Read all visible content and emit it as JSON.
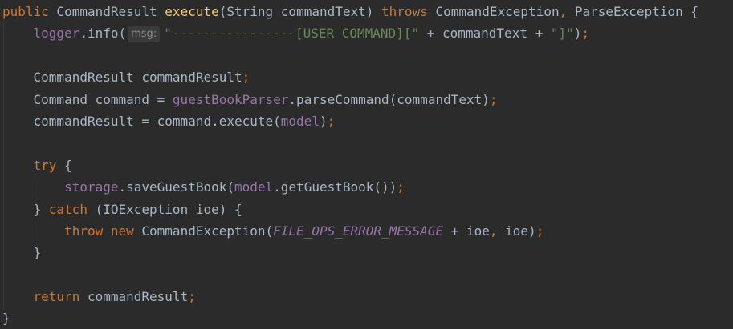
{
  "lines": [
    [
      {
        "t": "public",
        "c": "kw"
      },
      {
        "t": " CommandResult "
      },
      {
        "t": "execute",
        "c": "fn"
      },
      {
        "t": "(String commandText) "
      },
      {
        "t": "throws",
        "c": "kw"
      },
      {
        "t": " CommandException"
      },
      {
        "t": ",",
        "c": "kw"
      },
      {
        "t": " ParseException {"
      }
    ],
    [
      {
        "t": "    "
      },
      {
        "t": "logger",
        "c": "fld"
      },
      {
        "t": ".info("
      },
      {
        "t": "msg:",
        "c": "hint"
      },
      {
        "t": "\"----------------[USER COMMAND][\"",
        "c": "str"
      },
      {
        "t": " + commandText + "
      },
      {
        "t": "\"]\"",
        "c": "str"
      },
      {
        "t": ")"
      },
      {
        "t": ";",
        "c": "kw"
      }
    ],
    [],
    [
      {
        "t": "    CommandResult commandResult"
      },
      {
        "t": ";",
        "c": "kw"
      }
    ],
    [
      {
        "t": "    Command command = "
      },
      {
        "t": "guestBookParser",
        "c": "fld"
      },
      {
        "t": ".parseCommand(commandText)"
      },
      {
        "t": ";",
        "c": "kw"
      }
    ],
    [
      {
        "t": "    commandResult = command.execute("
      },
      {
        "t": "model",
        "c": "fld"
      },
      {
        "t": ")"
      },
      {
        "t": ";",
        "c": "kw"
      }
    ],
    [],
    [
      {
        "t": "    "
      },
      {
        "t": "try",
        "c": "kw"
      },
      {
        "t": " {"
      }
    ],
    [
      {
        "t": "        "
      },
      {
        "t": "storage",
        "c": "fld"
      },
      {
        "t": ".saveGuestBook("
      },
      {
        "t": "model",
        "c": "fld"
      },
      {
        "t": ".getGuestBook())"
      },
      {
        "t": ";",
        "c": "kw"
      }
    ],
    [
      {
        "t": "    } "
      },
      {
        "t": "catch",
        "c": "kw"
      },
      {
        "t": " (IOException ioe) {"
      }
    ],
    [
      {
        "t": "        "
      },
      {
        "t": "throw new",
        "c": "kw"
      },
      {
        "t": " CommandException("
      },
      {
        "t": "FILE_OPS_ERROR_MESSAGE",
        "c": "const"
      },
      {
        "t": " + ioe"
      },
      {
        "t": ",",
        "c": "kw"
      },
      {
        "t": " ioe)"
      },
      {
        "t": ";",
        "c": "kw"
      }
    ],
    [
      {
        "t": "    }"
      }
    ],
    [],
    [
      {
        "t": "    "
      },
      {
        "t": "return",
        "c": "kw"
      },
      {
        "t": " commandResult"
      },
      {
        "t": ";",
        "c": "kw"
      }
    ],
    [
      {
        "t": "}"
      }
    ]
  ],
  "colors": {
    "background": "#2b2b2b",
    "default_text": "#a9b7c6",
    "keyword": "#cc7832",
    "method_declaration": "#ffc66d",
    "string": "#6a8759",
    "field": "#9876aa",
    "inlay_hint_bg": "#3b3b3b",
    "inlay_hint_text": "#8c8c8c"
  }
}
